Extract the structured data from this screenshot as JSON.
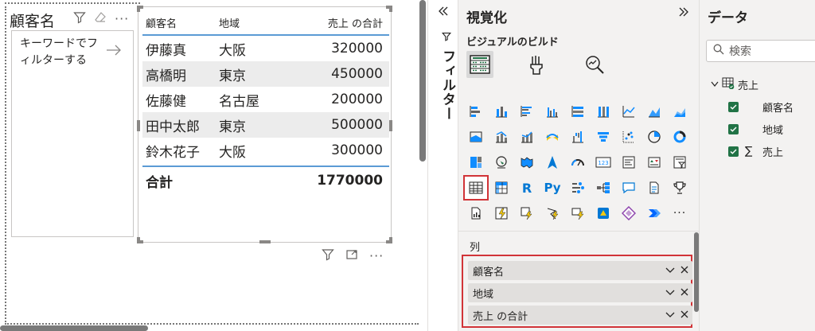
{
  "slicer": {
    "title": "顧客名",
    "prompt": "キーワードでフィルターする"
  },
  "table": {
    "headers": [
      "顧客名",
      "地域",
      "売上 の合計"
    ],
    "rows": [
      [
        "伊藤真",
        "大阪",
        "320000"
      ],
      [
        "高橋明",
        "東京",
        "450000"
      ],
      [
        "佐藤健",
        "名古屋",
        "200000"
      ],
      [
        "田中太郎",
        "東京",
        "500000"
      ],
      [
        "鈴木花子",
        "大阪",
        "300000"
      ]
    ],
    "total": {
      "label": "合計",
      "value": "1770000"
    }
  },
  "filters": {
    "label": "フィルター"
  },
  "visualizations": {
    "title": "視覚化",
    "subtitle": "ビジュアルのビルド",
    "well_label": "列",
    "fields": [
      "顧客名",
      "地域",
      "売上 の合計"
    ],
    "colors": {
      "accent": "#d13438",
      "brand_yellow": "#f2c811",
      "blue": "#118dff"
    }
  },
  "data_pane": {
    "title": "データ",
    "search_placeholder": "検索",
    "table_name": "売上",
    "fields": [
      {
        "name": "顧客名",
        "checked": true
      },
      {
        "name": "地域",
        "checked": true
      },
      {
        "name": "売上",
        "checked": true,
        "sigma": true
      }
    ]
  }
}
